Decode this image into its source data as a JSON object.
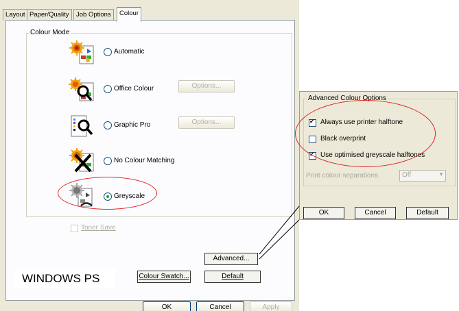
{
  "tabs": [
    {
      "label": "Layout",
      "active": false
    },
    {
      "label": "Paper/Quality",
      "active": false
    },
    {
      "label": "Job Options",
      "active": false
    },
    {
      "label": "Colour",
      "active": true
    }
  ],
  "colour_mode": {
    "title": "Colour Mode",
    "options": [
      {
        "label": "Automatic",
        "selected": false,
        "icon": "automatic-colour-icon"
      },
      {
        "label": "Office Colour",
        "selected": false,
        "icon": "office-colour-icon",
        "button": "Options..."
      },
      {
        "label": "Graphic Pro",
        "selected": false,
        "icon": "graphic-pro-icon",
        "button": "Options..."
      },
      {
        "label": "No Colour Matching",
        "selected": false,
        "icon": "no-colour-matching-icon"
      },
      {
        "label": "Greyscale",
        "selected": true,
        "icon": "greyscale-icon"
      }
    ]
  },
  "toner_save": {
    "label": "Toner Save",
    "checked": false,
    "disabled": true
  },
  "caption": "WINDOWS PS",
  "buttons": {
    "advanced": "Advanced...",
    "colour_swatch": "Colour Swatch...",
    "default": "Default",
    "ok": "OK",
    "cancel": "Cancel",
    "apply": "Apply"
  },
  "advanced_panel": {
    "title": "Advanced Colour Options",
    "options": [
      {
        "label": "Always use printer halftone",
        "checked": true
      },
      {
        "label": "Black overprint",
        "checked": false
      },
      {
        "label": "Use optimised greyscale halftones",
        "checked": true
      }
    ],
    "separations_label": "Print colour separations",
    "separations_value": "Off",
    "ok": "OK",
    "cancel": "Cancel",
    "default": "Default"
  },
  "colors": {
    "highlight": "#e02424",
    "dialog_bg": "#ece9d8",
    "tab_accent": "#e68b2c"
  }
}
